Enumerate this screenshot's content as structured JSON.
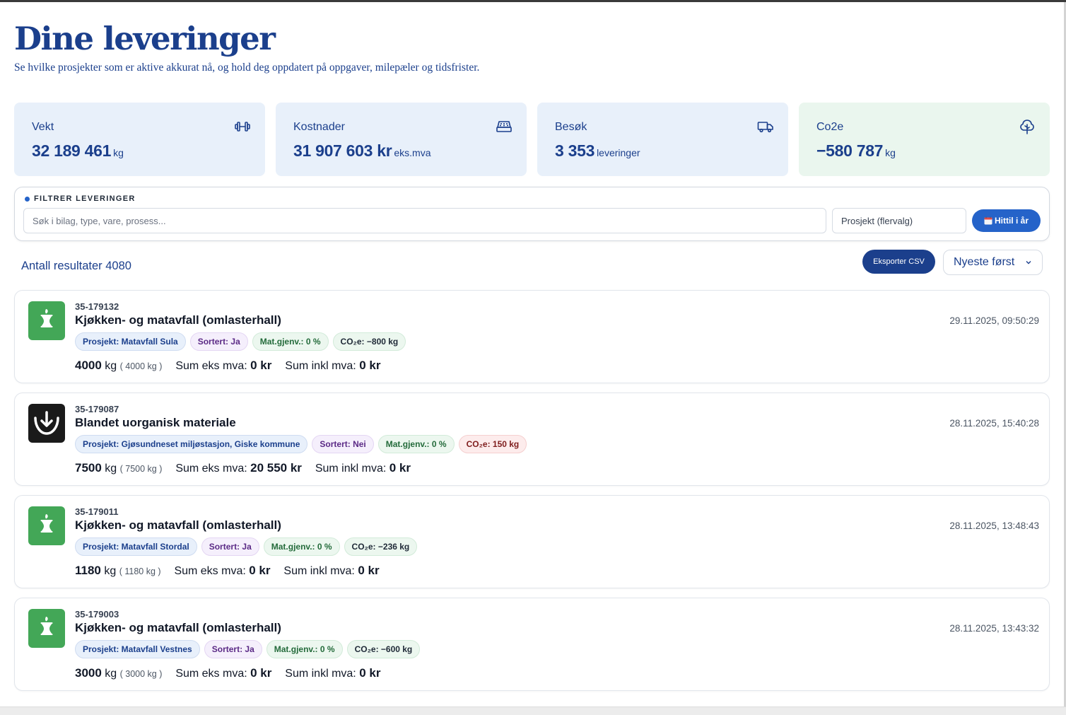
{
  "header": {
    "title": "Dine leveringer",
    "subtitle": "Se hvilke prosjekter som er aktive akkurat nå, og hold deg oppdatert på oppgaver, milepæler og tidsfrister."
  },
  "stats": [
    {
      "label": "Vekt",
      "value": "32 189 461",
      "unit": "kg",
      "icon": "dumbbell-icon"
    },
    {
      "label": "Kostnader",
      "value": "31 907 603 kr",
      "unit": "eks.mva",
      "icon": "cash-register-icon"
    },
    {
      "label": "Besøk",
      "value": "3 353",
      "unit": "leveringer",
      "icon": "truck-icon"
    },
    {
      "label": "Co2e",
      "value": "−580 787",
      "unit": "kg",
      "icon": "tree-icon",
      "accent": "#eaf6ee"
    }
  ],
  "filter": {
    "title": "FILTRER LEVERINGER",
    "search_placeholder": "Søk i bilag, type, vare, prosess...",
    "project_placeholder": "Prosjekt (flervalg)",
    "date_button": "Hittil i år"
  },
  "results": {
    "count_label": "Antall resultater 4080",
    "export_label": "Eksporter CSV",
    "sort_value": "Nyeste først"
  },
  "colors": {
    "brand": "#1b3f8c",
    "accent": "#2563c9",
    "food_waste": "#43a757"
  },
  "deliveries": [
    {
      "ref": "35-179132",
      "title": "Kjøkken- og matavfall (omlasterhall)",
      "date": "29.11.2025, 09:50:29",
      "icon": "apple-core-icon",
      "project": "Prosjekt:  Matavfall Sula",
      "sorted": "Sortert:  Ja",
      "mat": "Mat.gjenv.:  0  %",
      "co2": "CO₂e:  −800  kg",
      "co2_positive": false,
      "weight": "4000",
      "weight_unit": "kg",
      "weight_detail": "( 4000 kg )",
      "sum_ex_label": "Sum eks mva:",
      "sum_ex": "0 kr",
      "sum_inc_label": "Sum inkl mva:",
      "sum_inc": "0 kr"
    },
    {
      "ref": "35-179087",
      "title": "Blandet uorganisk materiale",
      "date": "28.11.2025, 15:40:28",
      "icon": "mixed-waste-icon",
      "project": "Prosjekt:  Gjøsundneset miljøstasjon, Giske kommune",
      "sorted": "Sortert:  Nei",
      "mat": "Mat.gjenv.:  0  %",
      "co2": "CO₂e:  150  kg",
      "co2_positive": true,
      "weight": "7500",
      "weight_unit": "kg",
      "weight_detail": "( 7500 kg )",
      "sum_ex_label": "Sum eks mva:",
      "sum_ex": "20 550 kr",
      "sum_inc_label": "Sum inkl mva:",
      "sum_inc": "0 kr"
    },
    {
      "ref": "35-179011",
      "title": "Kjøkken- og matavfall (omlasterhall)",
      "date": "28.11.2025, 13:48:43",
      "icon": "apple-core-icon",
      "project": "Prosjekt:  Matavfall Stordal",
      "sorted": "Sortert:  Ja",
      "mat": "Mat.gjenv.:  0  %",
      "co2": "CO₂e:  −236  kg",
      "co2_positive": false,
      "weight": "1180",
      "weight_unit": "kg",
      "weight_detail": "( 1180 kg )",
      "sum_ex_label": "Sum eks mva:",
      "sum_ex": "0 kr",
      "sum_inc_label": "Sum inkl mva:",
      "sum_inc": "0 kr"
    },
    {
      "ref": "35-179003",
      "title": "Kjøkken- og matavfall (omlasterhall)",
      "date": "28.11.2025, 13:43:32",
      "icon": "apple-core-icon",
      "project": "Prosjekt:  Matavfall Vestnes",
      "sorted": "Sortert:  Ja",
      "mat": "Mat.gjenv.:  0  %",
      "co2": "CO₂e:  −600  kg",
      "co2_positive": false,
      "weight": "3000",
      "weight_unit": "kg",
      "weight_detail": "( 3000 kg )",
      "sum_ex_label": "Sum eks mva:",
      "sum_ex": "0 kr",
      "sum_inc_label": "Sum inkl mva:",
      "sum_inc": "0 kr"
    }
  ]
}
